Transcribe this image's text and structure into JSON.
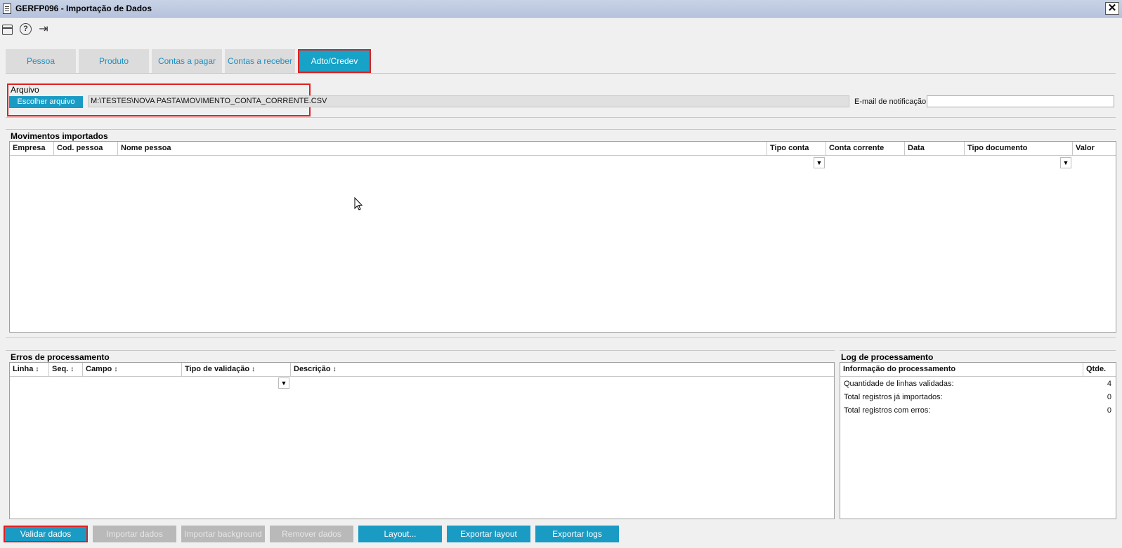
{
  "window": {
    "title": "GERFP096 - Importação de Dados",
    "close_glyph": "✕"
  },
  "toolbar": {
    "calendar_icon": "calendar-icon",
    "help_glyph": "?",
    "exit_glyph": "⇥"
  },
  "tabs": [
    {
      "label": "Pessoa",
      "active": false
    },
    {
      "label": "Produto",
      "active": false
    },
    {
      "label": "Contas a pagar",
      "active": false
    },
    {
      "label": "Contas a receber",
      "active": false
    },
    {
      "label": "Adto/Credev",
      "active": true
    }
  ],
  "arquivo": {
    "section_label": "Arquivo",
    "choose_button": "Escolher arquivo",
    "path": "M:\\TESTES\\NOVA PASTA\\MOVIMENTO_CONTA_CORRENTE.CSV",
    "email_label": "E-mail de notificação",
    "email_value": ""
  },
  "movimentos": {
    "section_label": "Movimentos importados",
    "columns": [
      "Empresa",
      "Cod. pessoa",
      "Nome pessoa",
      "Tipo conta",
      "Conta corrente",
      "Data",
      "Tipo documento",
      "Valor"
    ],
    "rows": []
  },
  "erros": {
    "section_label": "Erros de processamento",
    "columns": [
      "Linha",
      "Seq.",
      "Campo",
      "Tipo de validação",
      "Descrição"
    ],
    "sort_glyph": "↕",
    "rows": []
  },
  "log": {
    "section_label": "Log de processamento",
    "columns": [
      "Informação do processamento",
      "Qtde."
    ],
    "rows": [
      {
        "info": "Quantidade de linhas validadas:",
        "qtde": "4"
      },
      {
        "info": "Total registros já importados:",
        "qtde": "0"
      },
      {
        "info": "Total registros com erros:",
        "qtde": "0"
      }
    ]
  },
  "buttons": {
    "validar": "Validar dados",
    "importar": "Importar dados",
    "importar_bg": "Importar background",
    "remover": "Remover dados",
    "layout": "Layout...",
    "exportar_layout": "Exportar layout",
    "exportar_logs": "Exportar logs"
  },
  "colors": {
    "accent": "#1a9bc4",
    "highlight": "#e02020",
    "disabled": "#b9b9b9"
  }
}
